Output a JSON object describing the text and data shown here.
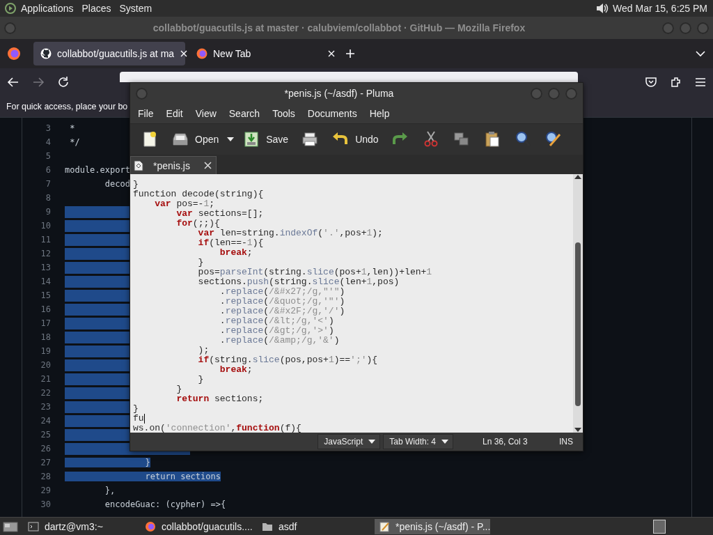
{
  "top_panel": {
    "menus": [
      "Applications",
      "Places",
      "System"
    ],
    "clock": "Wed Mar 15,  6:25 PM"
  },
  "firefox": {
    "title": "collabbot/guacutils.js at master · calubviem/collabbot · GitHub — Mozilla Firefox",
    "tabs": [
      {
        "label": "collabbot/guacutils.js at ma",
        "selected": true
      },
      {
        "label": "New Tab",
        "selected": false
      }
    ],
    "bookmarks_hint": "For quick access, place your bo",
    "code_lines": [
      {
        "number": "3",
        "text": " *",
        "selected": false
      },
      {
        "number": "4",
        "text": " */",
        "selected": false
      },
      {
        "number": "5",
        "selected": false
      },
      {
        "number": "6",
        "text": "module.export",
        "selected": false
      },
      {
        "number": "7",
        "text": "        decod",
        "selected": false
      },
      {
        "number": "8",
        "selected": false
      },
      {
        "number": "9",
        "selected": true
      },
      {
        "number": "10",
        "selected": true
      },
      {
        "number": "11",
        "selected": true
      },
      {
        "number": "12",
        "selected": true
      },
      {
        "number": "13",
        "selected": true
      },
      {
        "number": "14",
        "selected": true
      },
      {
        "number": "15",
        "selected": true
      },
      {
        "number": "16",
        "selected": true
      },
      {
        "number": "17",
        "selected": true
      },
      {
        "number": "18",
        "selected": true
      },
      {
        "number": "19",
        "selected": true
      },
      {
        "number": "20",
        "selected": true
      },
      {
        "number": "21",
        "selected": true
      },
      {
        "number": "22",
        "selected": true
      },
      {
        "number": "23",
        "selected": true
      },
      {
        "number": "24",
        "selected": true
      },
      {
        "number": "25",
        "selected": true
      },
      {
        "number": "26",
        "selected": true
      },
      {
        "number": "27",
        "text": "                }",
        "selected": true
      },
      {
        "number": "28",
        "text": "                return sections",
        "selected": true
      },
      {
        "number": "29",
        "text": "        },",
        "selected": false
      },
      {
        "number": "30",
        "text": "        encodeGuac: (cypher) =>{",
        "selected": false
      }
    ]
  },
  "pluma": {
    "title": "*penis.js (~/asdf) - Pluma",
    "menus": [
      "File",
      "Edit",
      "View",
      "Search",
      "Tools",
      "Documents",
      "Help"
    ],
    "toolbar": [
      {
        "kind": "new"
      },
      {
        "kind": "open",
        "label": "Open"
      },
      {
        "kind": "save",
        "label": "Save"
      },
      {
        "kind": "print"
      },
      {
        "kind": "undo",
        "label": "Undo"
      },
      {
        "kind": "redo"
      },
      {
        "kind": "cut"
      },
      {
        "kind": "copy"
      },
      {
        "kind": "paste"
      },
      {
        "kind": "find"
      },
      {
        "kind": "replace"
      }
    ],
    "tab": "*penis.js",
    "lines": [
      {
        "cursor": false,
        "segments": [
          {
            "kind": "plain",
            "text": "}"
          }
        ]
      },
      {
        "cursor": false,
        "segments": [
          {
            "kind": "plain",
            "text": "function decode(string){"
          }
        ]
      },
      {
        "cursor": false,
        "segments": [
          {
            "kind": "keyword",
            "text": "    var"
          },
          {
            "kind": "plain",
            "text": " pos=-"
          },
          {
            "kind": "literal",
            "text": "1"
          },
          {
            "kind": "plain",
            "text": ";"
          }
        ]
      },
      {
        "cursor": false,
        "segments": [
          {
            "kind": "keyword",
            "text": "        var"
          },
          {
            "kind": "plain",
            "text": " sections=[];"
          }
        ]
      },
      {
        "cursor": false,
        "segments": [
          {
            "kind": "keyword",
            "text": "        for"
          },
          {
            "kind": "plain",
            "text": "(;;){"
          }
        ]
      },
      {
        "cursor": false,
        "segments": [
          {
            "kind": "keyword",
            "text": "            var"
          },
          {
            "kind": "plain",
            "text": " len=string."
          },
          {
            "kind": "method",
            "text": "indexOf"
          },
          {
            "kind": "plain",
            "text": "("
          },
          {
            "kind": "literal",
            "text": "'.'"
          },
          {
            "kind": "plain",
            "text": ",pos+"
          },
          {
            "kind": "literal",
            "text": "1"
          },
          {
            "kind": "plain",
            "text": ");"
          }
        ]
      },
      {
        "cursor": false,
        "segments": [
          {
            "kind": "keyword",
            "text": "            if"
          },
          {
            "kind": "plain",
            "text": "(len==-"
          },
          {
            "kind": "literal",
            "text": "1"
          },
          {
            "kind": "plain",
            "text": "){"
          }
        ]
      },
      {
        "cursor": false,
        "segments": [
          {
            "kind": "keyword",
            "text": "                break"
          },
          {
            "kind": "plain",
            "text": ";"
          }
        ]
      },
      {
        "cursor": false,
        "segments": [
          {
            "kind": "plain",
            "text": "            }"
          }
        ]
      },
      {
        "cursor": false,
        "segments": [
          {
            "kind": "plain",
            "text": "            pos="
          },
          {
            "kind": "method",
            "text": "parseInt"
          },
          {
            "kind": "plain",
            "text": "(string."
          },
          {
            "kind": "method",
            "text": "slice"
          },
          {
            "kind": "plain",
            "text": "(pos+"
          },
          {
            "kind": "literal",
            "text": "1"
          },
          {
            "kind": "plain",
            "text": ",len))+len+"
          },
          {
            "kind": "literal",
            "text": "1"
          }
        ]
      },
      {
        "cursor": false,
        "segments": [
          {
            "kind": "plain",
            "text": "            sections."
          },
          {
            "kind": "method",
            "text": "push"
          },
          {
            "kind": "plain",
            "text": "(string."
          },
          {
            "kind": "method",
            "text": "slice"
          },
          {
            "kind": "plain",
            "text": "(len+"
          },
          {
            "kind": "literal",
            "text": "1"
          },
          {
            "kind": "plain",
            "text": ",pos)"
          }
        ]
      },
      {
        "cursor": false,
        "segments": [
          {
            "kind": "plain",
            "text": "                ."
          },
          {
            "kind": "method",
            "text": "replace"
          },
          {
            "kind": "plain",
            "text": "("
          },
          {
            "kind": "literal",
            "text": "/&#x27;/g,\"'\""
          },
          {
            "kind": "plain",
            "text": ")"
          }
        ]
      },
      {
        "cursor": false,
        "segments": [
          {
            "kind": "plain",
            "text": "                ."
          },
          {
            "kind": "method",
            "text": "replace"
          },
          {
            "kind": "plain",
            "text": "("
          },
          {
            "kind": "literal",
            "text": "/&quot;/g,'\"'"
          },
          {
            "kind": "plain",
            "text": ")"
          }
        ]
      },
      {
        "cursor": false,
        "segments": [
          {
            "kind": "plain",
            "text": "                ."
          },
          {
            "kind": "method",
            "text": "replace"
          },
          {
            "kind": "plain",
            "text": "("
          },
          {
            "kind": "literal",
            "text": "/&#x2F;/g,'/'"
          },
          {
            "kind": "plain",
            "text": ")"
          }
        ]
      },
      {
        "cursor": false,
        "segments": [
          {
            "kind": "plain",
            "text": "                ."
          },
          {
            "kind": "method",
            "text": "replace"
          },
          {
            "kind": "plain",
            "text": "("
          },
          {
            "kind": "literal",
            "text": "/&lt;/g,'<'"
          },
          {
            "kind": "plain",
            "text": ")"
          }
        ]
      },
      {
        "cursor": false,
        "segments": [
          {
            "kind": "plain",
            "text": "                ."
          },
          {
            "kind": "method",
            "text": "replace"
          },
          {
            "kind": "plain",
            "text": "("
          },
          {
            "kind": "literal",
            "text": "/&gt;/g,'>'"
          },
          {
            "kind": "plain",
            "text": ")"
          }
        ]
      },
      {
        "cursor": false,
        "segments": [
          {
            "kind": "plain",
            "text": "                ."
          },
          {
            "kind": "method",
            "text": "replace"
          },
          {
            "kind": "plain",
            "text": "("
          },
          {
            "kind": "literal",
            "text": "/&amp;/g,'&'"
          },
          {
            "kind": "plain",
            "text": ")"
          }
        ]
      },
      {
        "cursor": false,
        "segments": [
          {
            "kind": "plain",
            "text": "            );"
          }
        ]
      },
      {
        "cursor": false,
        "segments": [
          {
            "kind": "keyword",
            "text": "            if"
          },
          {
            "kind": "plain",
            "text": "(string."
          },
          {
            "kind": "method",
            "text": "slice"
          },
          {
            "kind": "plain",
            "text": "(pos,pos+"
          },
          {
            "kind": "literal",
            "text": "1"
          },
          {
            "kind": "plain",
            "text": ")=="
          },
          {
            "kind": "literal",
            "text": "';'"
          },
          {
            "kind": "plain",
            "text": "){"
          }
        ]
      },
      {
        "cursor": false,
        "segments": [
          {
            "kind": "keyword",
            "text": "                break"
          },
          {
            "kind": "plain",
            "text": ";"
          }
        ]
      },
      {
        "cursor": false,
        "segments": [
          {
            "kind": "plain",
            "text": "            }"
          }
        ]
      },
      {
        "cursor": false,
        "segments": [
          {
            "kind": "plain",
            "text": "        }"
          }
        ]
      },
      {
        "cursor": false,
        "segments": [
          {
            "kind": "keyword",
            "text": "        return"
          },
          {
            "kind": "plain",
            "text": " sections;"
          }
        ]
      },
      {
        "cursor": false,
        "segments": [
          {
            "kind": "plain",
            "text": "}"
          }
        ]
      },
      {
        "cursor": true,
        "segments": [
          {
            "kind": "plain",
            "text": "fu"
          }
        ]
      },
      {
        "cursor": false,
        "segments": [
          {
            "kind": "plain",
            "text": "ws.on("
          },
          {
            "kind": "literal",
            "text": "'connection'"
          },
          {
            "kind": "plain",
            "text": ","
          },
          {
            "kind": "keyword",
            "text": "function"
          },
          {
            "kind": "plain",
            "text": "(f){"
          }
        ]
      }
    ],
    "status": {
      "language": "JavaScript",
      "tab_width": "Tab Width:  4",
      "position": "Ln 36, Col 3",
      "mode": "INS"
    }
  },
  "taskbar": {
    "items": [
      {
        "kind": "terminal",
        "label": "dartz@vm3:~",
        "selected": false
      },
      {
        "kind": "browser",
        "label": "collabbot/guacutils....",
        "selected": false
      },
      {
        "kind": "folder",
        "label": "asdf",
        "selected": false
      },
      {
        "kind": "editor",
        "label": "*penis.js (~/asdf) - P...",
        "selected": true
      }
    ]
  }
}
